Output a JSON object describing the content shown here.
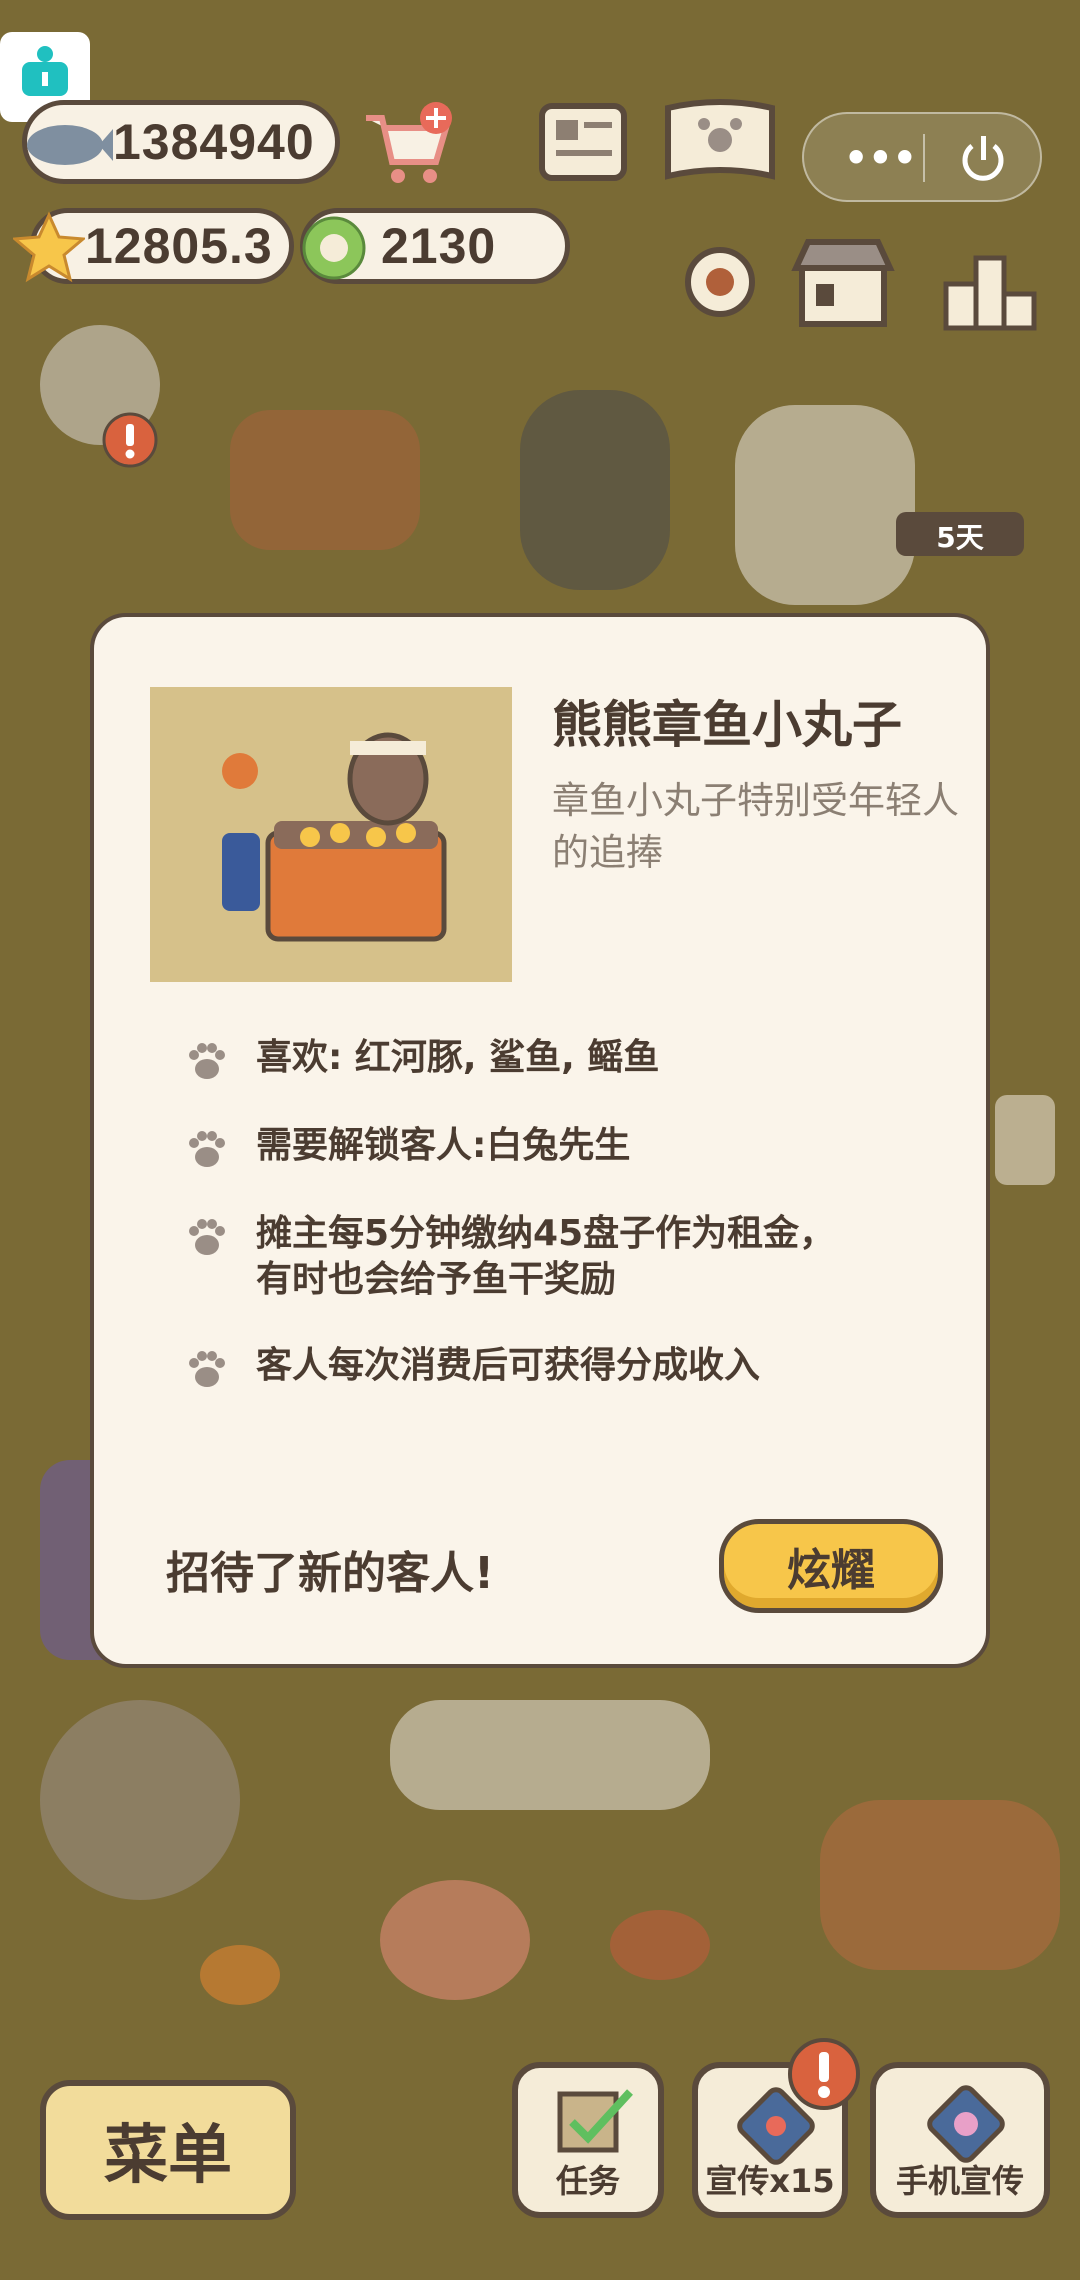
{
  "hud": {
    "fish_value": "1384940",
    "star_value": "12805.3",
    "coin_value": "2130",
    "timer_badge": "5天"
  },
  "modal": {
    "title": "熊熊章鱼小丸子",
    "subtitle": "章鱼小丸子特别受年轻人的追捧",
    "bullets": [
      "喜欢: 红河豚, 鲨鱼, 鳐鱼",
      "需要解锁客人:白兔先生",
      "摊主每5分钟缴纳45盘子作为租金，",
      "有时也会给予鱼干奖励",
      "客人每次消费后可获得分成收入"
    ],
    "footer_text": "招待了新的客人!",
    "show_button": "炫耀"
  },
  "bottom": {
    "menu": "菜单",
    "tasks": "任务",
    "promote": "宣传x15",
    "phone_promote": "手机宣传"
  },
  "colors": {
    "background": "#7a6a35",
    "panel": "#faf4ea",
    "accent_yellow": "#f7c64a",
    "text_dark": "#4b3c31"
  }
}
